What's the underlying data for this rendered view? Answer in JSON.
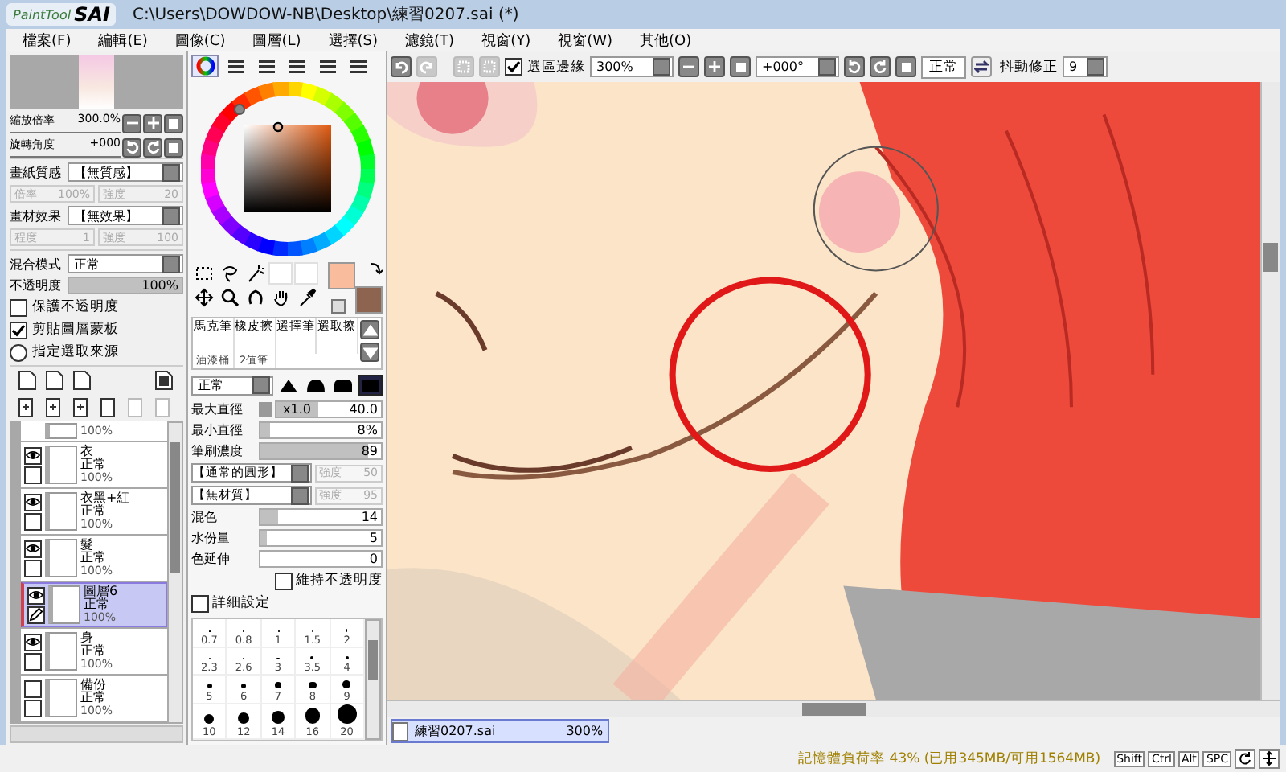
{
  "window": {
    "title": "C:\\Users\\DOWDOW-NB\\Desktop\\練習0207.sai (*)"
  },
  "logo": {
    "small": "PaintTool",
    "big": "SAI"
  },
  "menu": [
    "檔案(F)",
    "編輯(E)",
    "圖像(C)",
    "圖層(L)",
    "選擇(S)",
    "濾鏡(T)",
    "視窗(Y)",
    "視窗(W)",
    "其他(O)"
  ],
  "navigator": {
    "zoom_label": "縮放倍率",
    "zoom": "300.0%",
    "rotate_label": "旋轉角度",
    "rotate": "+000"
  },
  "texture": [
    {
      "label": "畫紙質感",
      "value": "【無質感】",
      "sub": [
        {
          "label": "倍率",
          "value": "100%",
          "disabled": true
        },
        {
          "label": "強度",
          "value": "20",
          "disabled": true
        }
      ]
    },
    {
      "label": "畫材效果",
      "value": "【無效果】",
      "sub": [
        {
          "label": "程度",
          "value": "1",
          "disabled": true
        },
        {
          "label": "強度",
          "value": "100",
          "disabled": true
        }
      ]
    }
  ],
  "blend": {
    "label": "混合模式",
    "value": "正常"
  },
  "opacity": {
    "label": "不透明度",
    "value": "100%",
    "level": 1
  },
  "layer_options": [
    {
      "kind": "checkbox",
      "label": "保護不透明度",
      "checked": false
    },
    {
      "kind": "checkbox",
      "label": "剪貼圖層蒙板",
      "checked": true
    },
    {
      "kind": "radio",
      "label": "指定選取來源",
      "checked": false
    }
  ],
  "layers": [
    {
      "kind": "partial",
      "opacity": "100%",
      "selected": false
    },
    {
      "kind": "layer",
      "name": "衣",
      "mode": "正常",
      "opacity": "100%",
      "visible": true,
      "selected": false
    },
    {
      "kind": "layer",
      "name": "衣黑+紅",
      "mode": "正常",
      "opacity": "100%",
      "visible": true,
      "selected": false
    },
    {
      "kind": "layer",
      "name": "髮",
      "mode": "正常",
      "opacity": "100%",
      "visible": true,
      "selected": false
    },
    {
      "kind": "layer",
      "name": "圖層6",
      "mode": "正常",
      "opacity": "100%",
      "visible": true,
      "selected": true
    },
    {
      "kind": "layer",
      "name": "身",
      "mode": "正常",
      "opacity": "100%",
      "visible": true,
      "selected": false
    },
    {
      "kind": "layer",
      "name": "備份",
      "mode": "正常",
      "opacity": "100%",
      "visible": false,
      "selected": false
    }
  ],
  "color_tabs": [
    {
      "selected": true
    },
    {
      "selected": false
    },
    {
      "selected": false
    },
    {
      "selected": false
    },
    {
      "selected": false
    },
    {
      "selected": false
    }
  ],
  "swatches": [
    {
      "kind": "foreground",
      "color": "#f9bd9e"
    },
    {
      "kind": "background",
      "color": "#8c6450"
    }
  ],
  "brush_tools": [
    "馬克筆",
    "橡皮擦",
    "選擇筆",
    "選取擦",
    "油漆桶",
    "2值筆"
  ],
  "brush_mode": "正常",
  "tip_shapes": [
    {
      "selected": false
    },
    {
      "selected": false
    },
    {
      "selected": false
    },
    {
      "selected": true
    }
  ],
  "brush_params": [
    {
      "kind": "multiplier",
      "label": "最大直徑",
      "multiplier": "x1.0",
      "value": "40.0",
      "level": 0.4
    },
    {
      "kind": "slider",
      "label": "最小直徑",
      "value": "8%",
      "level": 0.08
    },
    {
      "kind": "slider",
      "label": "筆刷濃度",
      "value": "89",
      "level": 0.89
    }
  ],
  "brush_shape": [
    {
      "value": "【通常的圓形】",
      "strength_label": "強度",
      "strength": "50",
      "disabled": true
    },
    {
      "value": "【無材質】",
      "strength_label": "強度",
      "strength": "95",
      "disabled": true
    }
  ],
  "mix_params": [
    {
      "label": "混色",
      "value": "14",
      "level": 0.14
    },
    {
      "label": "水份量",
      "value": "5",
      "level": 0.05
    },
    {
      "label": "色延伸",
      "value": "0",
      "level": 0
    }
  ],
  "keep_opacity": {
    "label": "維持不透明度",
    "checked": false
  },
  "detail": {
    "label": "詳細設定",
    "checked": false
  },
  "brush_sizes": [
    "0.7",
    "0.8",
    "1",
    "1.5",
    "2",
    "2.3",
    "2.6",
    "3",
    "3.5",
    "4",
    "5",
    "6",
    "7",
    "8",
    "9",
    "10",
    "12",
    "14",
    "16",
    "20"
  ],
  "toolbar": {
    "selection_edge": {
      "label": "選區邊緣",
      "checked": true
    },
    "zoom": "300%",
    "angle": "+000°",
    "mode_button": "正常",
    "stabilizer_label": "抖動修正",
    "stabilizer": "9"
  },
  "documents": [
    {
      "name": "練習0207.sai",
      "zoom": "300%",
      "selected": true
    }
  ],
  "status_bar": {
    "memory": "記憶體負荷率 43% (已用345MB/可用1564MB)",
    "keys": [
      "Shift",
      "Ctrl",
      "Alt",
      "SPC"
    ]
  }
}
